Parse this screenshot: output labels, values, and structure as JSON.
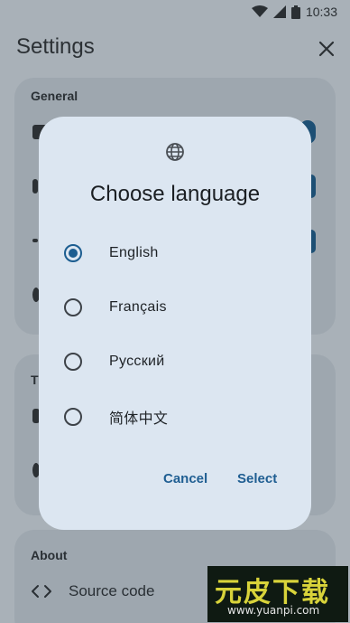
{
  "status_bar": {
    "time": "10:33"
  },
  "app_bar": {
    "title": "Settings"
  },
  "background_sections": {
    "general_label": "General",
    "theme_label_partial": "T",
    "about_label": "About",
    "source_code_label": "Source code"
  },
  "dialog": {
    "title": "Choose language",
    "options": [
      {
        "label": "English",
        "selected": true
      },
      {
        "label": "Français",
        "selected": false
      },
      {
        "label": "Русский",
        "selected": false
      },
      {
        "label": "简体中文",
        "selected": false
      }
    ],
    "cancel_label": "Cancel",
    "select_label": "Select"
  },
  "watermark": {
    "brand": "元皮下载",
    "url": "www.yuanpi.com"
  },
  "colors": {
    "accent": "#1c5d90",
    "dialog_bg": "#dce6f1",
    "scrim_bg": "#a9b1b8"
  }
}
